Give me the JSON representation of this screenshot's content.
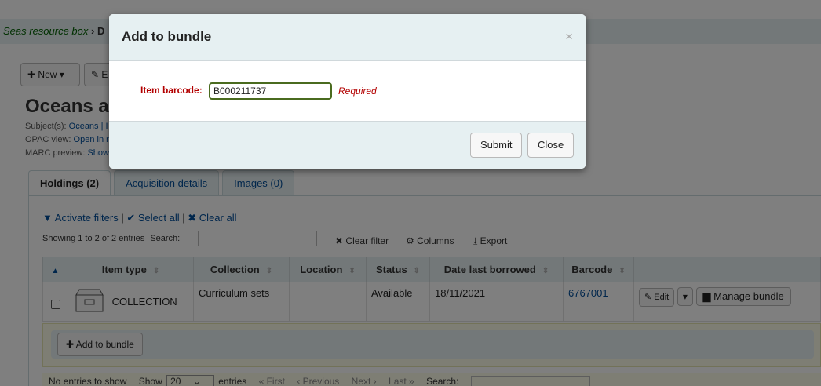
{
  "breadcrumb": {
    "link": "Seas resource box",
    "sep": "›",
    "current": "D"
  },
  "toolbar": {
    "new_label": "New",
    "new_icon": "plus-icon",
    "edit_label": "E"
  },
  "record": {
    "title": "Oceans an",
    "subjects_label": "Subject(s):",
    "subjects_value": "Oceans | I",
    "opac_label": "OPAC view:",
    "opac_value": "Open in r",
    "marc_label": "MARC preview:",
    "marc_value": "Show"
  },
  "tabs": [
    {
      "label": "Holdings (2)"
    },
    {
      "label": "Acquisition details"
    },
    {
      "label": "Images (0)"
    }
  ],
  "filters": {
    "activate": "Activate filters",
    "select_all": "Select all",
    "clear_all": "Clear all",
    "sep": "|"
  },
  "table_info": {
    "showing": "Showing 1 to 2 of 2 entries",
    "search_label": "Search:",
    "clear_filter": "Clear filter",
    "columns": "Columns",
    "export": "Export"
  },
  "table": {
    "headers": [
      "",
      "Item type",
      "Collection",
      "Location",
      "Status",
      "Date last borrowed",
      "Barcode",
      ""
    ],
    "rows": [
      {
        "item_type": "COLLECTION",
        "collection": "Curriculum sets",
        "location": "",
        "status": "Available",
        "date_last_borrowed": "18/11/2021",
        "barcode": "6767001",
        "edit": "Edit",
        "manage": "Manage bundle"
      }
    ]
  },
  "bundle": {
    "add_label": "Add to bundle"
  },
  "pager": {
    "no_entries": "No entries to show",
    "show": "Show",
    "page_size": "20",
    "entries": "entries",
    "first": "« First",
    "previous": "‹ Previous",
    "next": "Next ›",
    "last": "Last »",
    "search": "Search:"
  },
  "modal": {
    "title": "Add to bundle",
    "close_x": "×",
    "barcode_label": "Item barcode:",
    "barcode_value": "B000211737",
    "required": "Required",
    "submit": "Submit",
    "close": "Close"
  },
  "colors": {
    "accent": "#004d99",
    "link": "#006100",
    "required": "#b30000",
    "header_bg": "#e6f0f2"
  }
}
